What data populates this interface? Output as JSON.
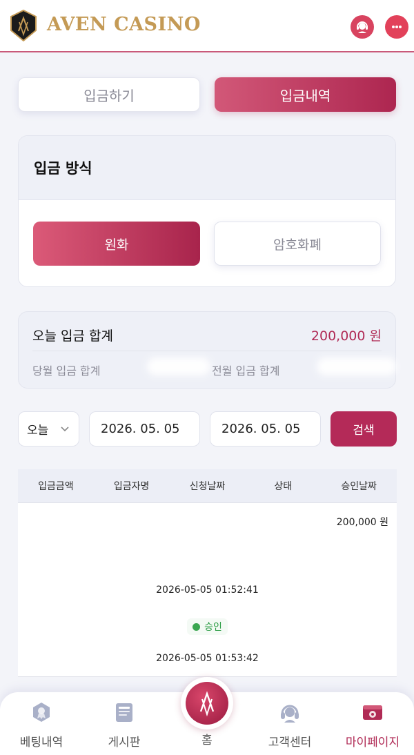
{
  "header": {
    "brand": "AVEN CASINO",
    "logo_text": "AV",
    "icons": [
      "support-agent-icon",
      "chat-bubble-icon"
    ],
    "accent_color": "#c49a55"
  },
  "tabs": {
    "deposit": "입금하기",
    "history": "입금내역",
    "active": "history"
  },
  "method": {
    "title": "입금 방식",
    "options": [
      "원화",
      "암호화폐"
    ],
    "selected": "원화"
  },
  "summary": {
    "today_label": "오늘 입금 합계",
    "today_value": "200,000 원",
    "month_label": "당월 입금 합계",
    "prev_month_label": "전월 입금 합계"
  },
  "filter": {
    "period": "오늘",
    "start_date": "2026. 05. 05",
    "end_date": "2026. 05. 05",
    "search_label": "검색"
  },
  "table": {
    "headers": [
      "입금금액",
      "입금자명",
      "신청날짜",
      "상태",
      "승인날짜"
    ],
    "row": {
      "amount": "200,000 원",
      "request_date": "2026-05-05 01:52:41",
      "status": "승인",
      "approval_date": "2026-05-05 01:53:42"
    }
  },
  "bottom_nav": {
    "items": [
      {
        "label": "베팅내역",
        "icon": "betting-history-icon"
      },
      {
        "label": "게시판",
        "icon": "board-icon"
      },
      {
        "label": "홈",
        "icon": "home-logo-icon"
      },
      {
        "label": "고객센터",
        "icon": "headset-icon"
      },
      {
        "label": "마이페이지",
        "icon": "mypage-icon"
      }
    ],
    "active": "마이페이지"
  },
  "colors": {
    "primary": "#b42a58",
    "status_green": "#3aa650",
    "background": "#f3f4f9"
  }
}
